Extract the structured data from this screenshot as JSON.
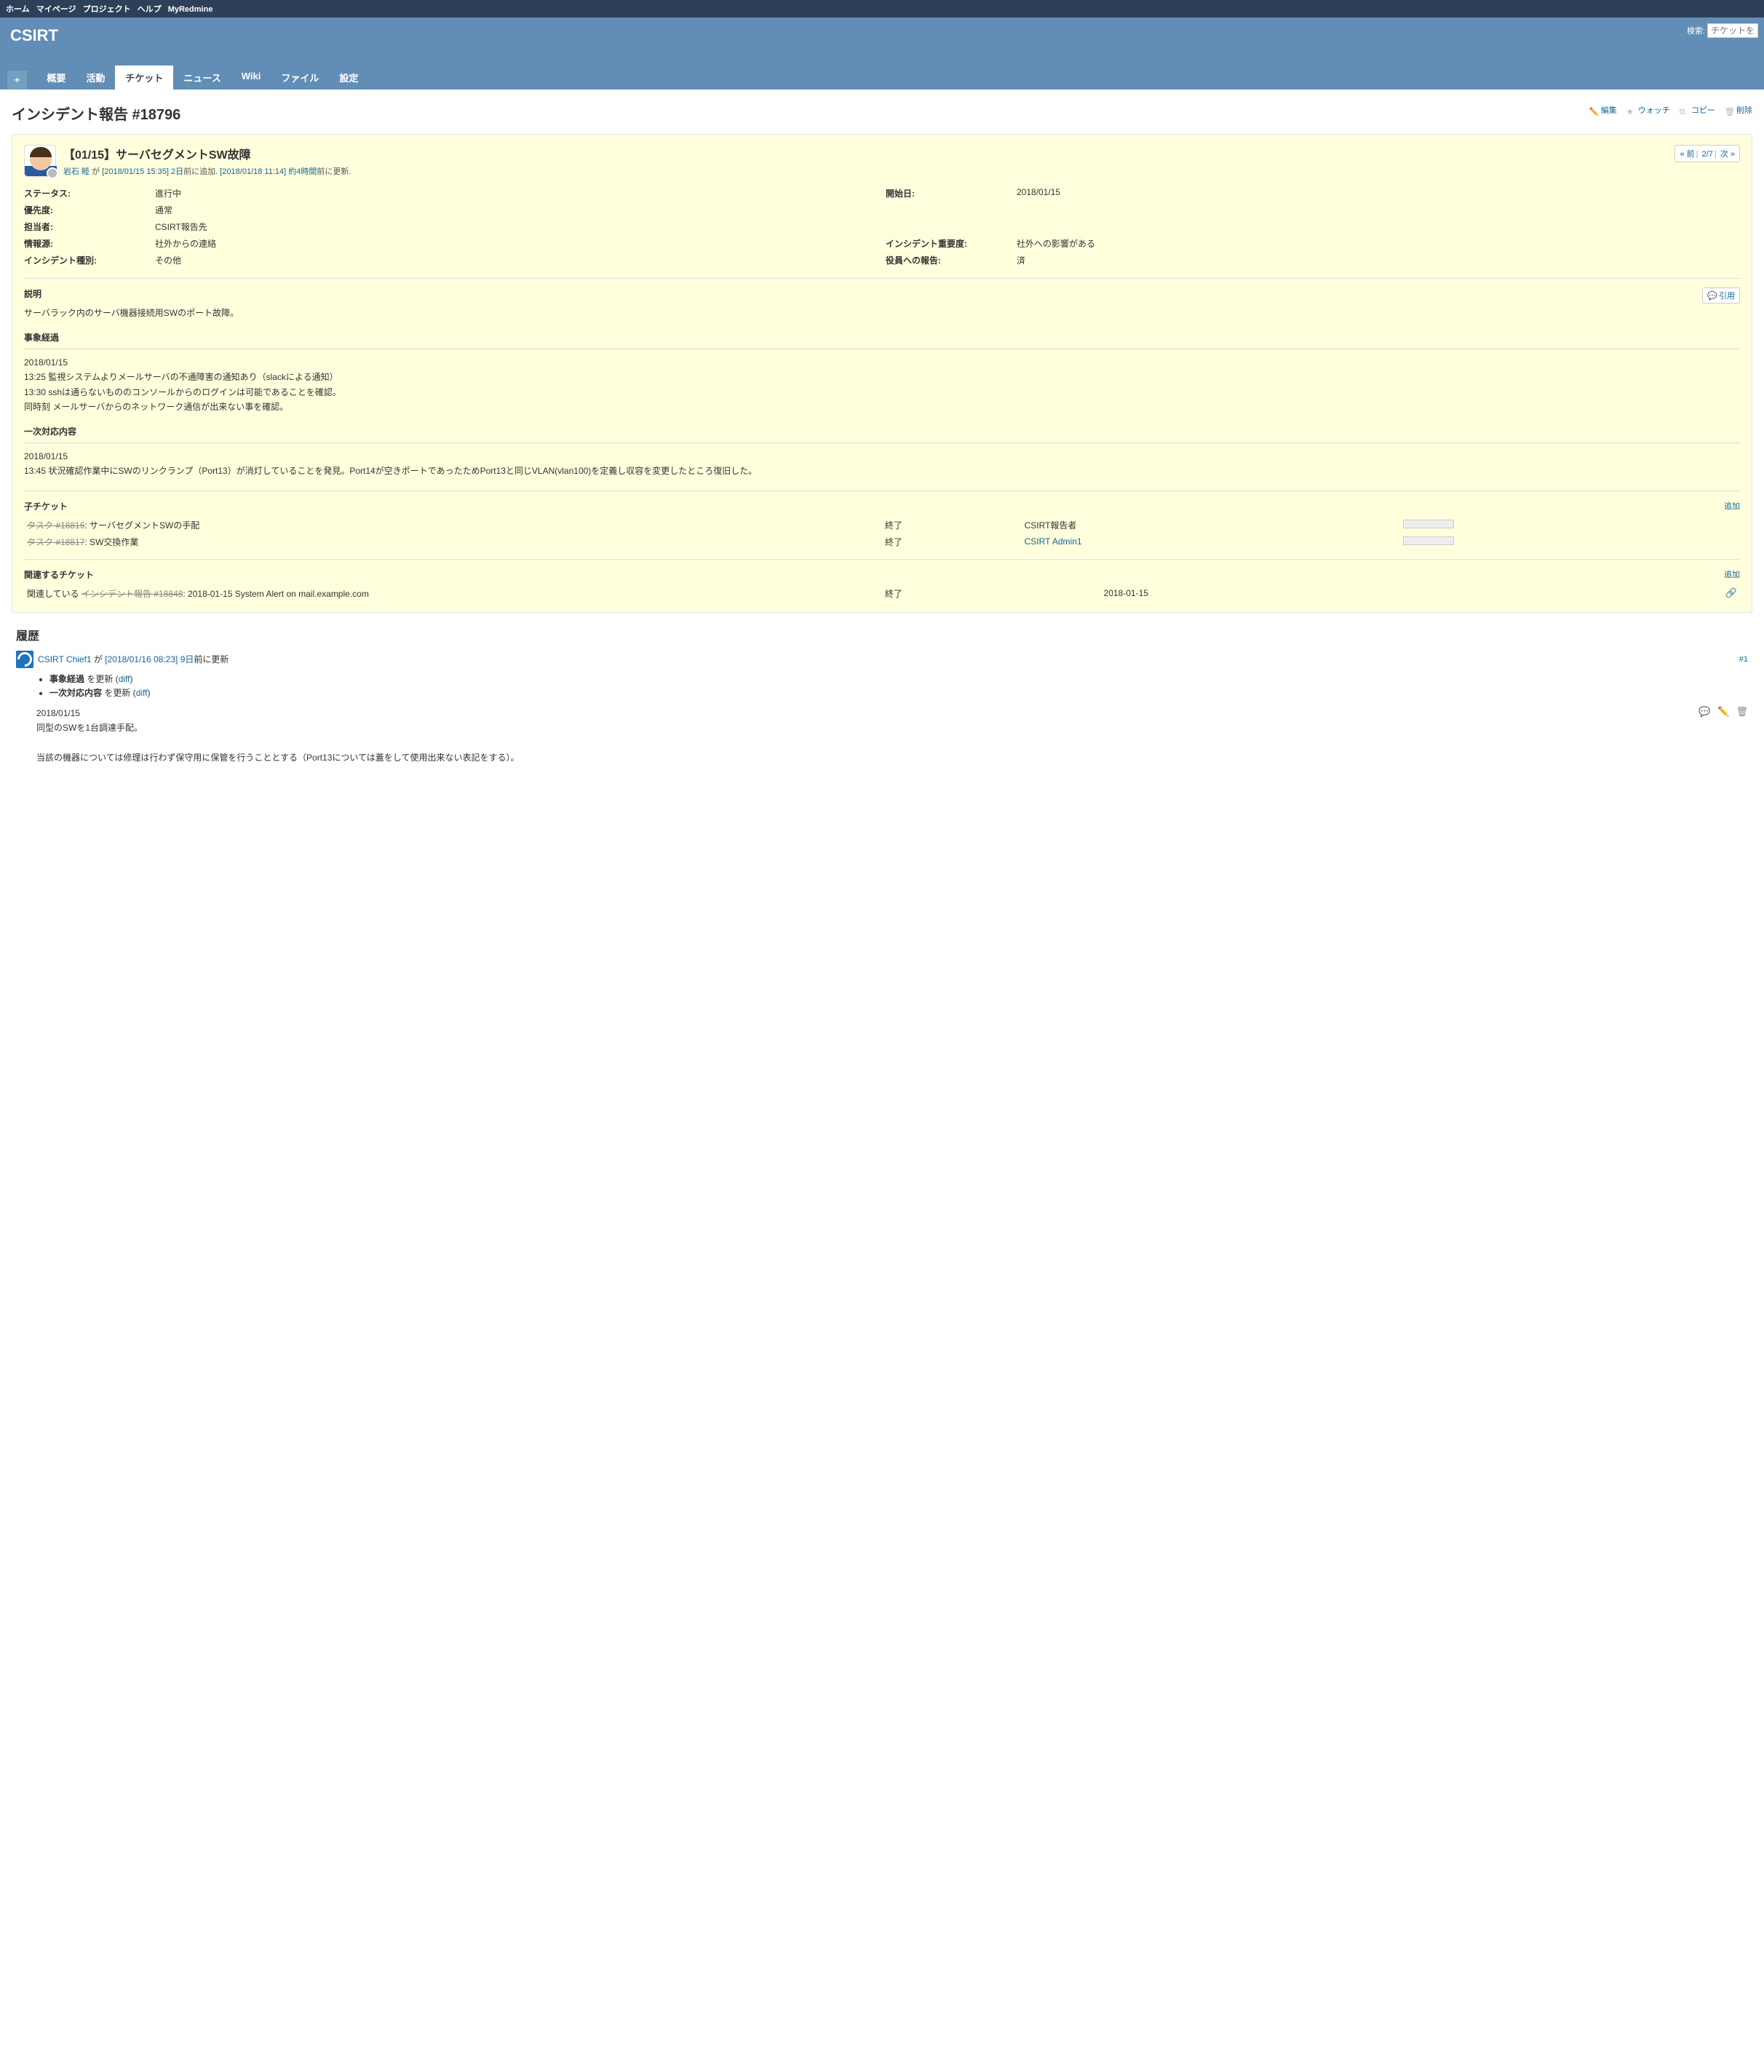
{
  "topbar": {
    "home": "ホーム",
    "mypage": "マイページ",
    "projects": "プロジェクト",
    "help": "ヘルプ",
    "myredmine": "MyRedmine"
  },
  "header": {
    "project": "CSIRT",
    "search_label": "検索:",
    "search_placeholder": "チケットを"
  },
  "mainmenu": {
    "plus": "+",
    "overview": "概要",
    "activity": "活動",
    "issues": "チケット",
    "news": "ニュース",
    "wiki": "Wiki",
    "files": "ファイル",
    "settings": "設定"
  },
  "contextual": {
    "edit": "編集",
    "watch": "ウォッチ",
    "copy": "コピー",
    "delete": "削除"
  },
  "page_title": "インシデント報告 #18796",
  "nav": {
    "prev": "« 前",
    "pos": "2/7",
    "next": "次 »"
  },
  "issue": {
    "title": "【01/15】サーバセグメントSW故障",
    "author": "岩石 睦",
    "meta_by": " が ",
    "created_ts": "[2018/01/15 15:35] 2日",
    "created_suffix": "前に追加. ",
    "updated_ts": "[2018/01/18 11:14] 約4時間",
    "updated_suffix": "前に更新."
  },
  "attrs": {
    "status_l": "ステータス:",
    "status_v": "進行中",
    "startdate_l": "開始日:",
    "startdate_v": "2018/01/15",
    "priority_l": "優先度:",
    "priority_v": "通常",
    "assignee_l": "担当者:",
    "assignee_v": "CSIRT報告先",
    "source_l": "情報源:",
    "source_v": "社外からの連絡",
    "severity_l": "インシデント重要度:",
    "severity_v": "社外への影響がある",
    "kind_l": "インシデント種別:",
    "kind_v": "その他",
    "exec_l": "役員への報告:",
    "exec_v": "済"
  },
  "desc": {
    "label": "説明",
    "quote": "引用",
    "summary": "サーバラック内のサーバ機器接続用SWのポート故障。",
    "h1": "事象経過",
    "p1a": "2018/01/15",
    "p1b": "13:25 監視システムよりメールサーバの不通障害の通知あり（slackによる通知）",
    "p1c": "13:30 sshは通らないもののコンソールからのログインは可能であることを確認。",
    "p1d": "同時刻 メールサーバからのネットワーク通信が出来ない事を確認。",
    "h2": "一次対応内容",
    "p2a": "2018/01/15",
    "p2b": "13:45 状況確認作業中にSWのリンクランプ（Port13）が消灯していることを発見。Port14が空きポートであったためPort13と同じVLAN(vlan100)を定義し収容を変更したところ復旧した。"
  },
  "subtickets": {
    "label": "子チケット",
    "add": "追加",
    "r1_link": "タスク #18816",
    "r1_subj": ": サーバセグメントSWの手配",
    "r1_status": "終了",
    "r1_assignee": "CSIRT報告者",
    "r2_link": "タスク #18817",
    "r2_subj": ": SW交換作業",
    "r2_status": "終了",
    "r2_assignee": "CSIRT Admin1"
  },
  "related": {
    "label": "関連するチケット",
    "add": "追加",
    "r1_prefix": "関連している ",
    "r1_link": "インシデント報告 #18848",
    "r1_subj": ": 2018-01-15 System Alert on mail.example.com",
    "r1_status": "終了",
    "r1_date": "2018-01-15"
  },
  "history": {
    "label": "履歴",
    "j1_user": "CSIRT Chief1",
    "j1_by": " が ",
    "j1_ts": "[2018/01/16 08:23] 9日",
    "j1_suffix": "前に更新",
    "j1_num": "#1",
    "j1_d1a": "事象経過",
    "j1_d1b": " を更新 (",
    "j1_diff": "diff",
    "j1_d1c": ")",
    "j1_d2a": "一次対応内容",
    "j1_d2b": " を更新 (",
    "j1_b1": "2018/01/15",
    "j1_b2": "同型のSWを1台調達手配。",
    "j1_b3": "当該の機器については修理は行わず保守用に保管を行うこととする（Port13については蓋をして使用出来ない表記をする）。"
  }
}
